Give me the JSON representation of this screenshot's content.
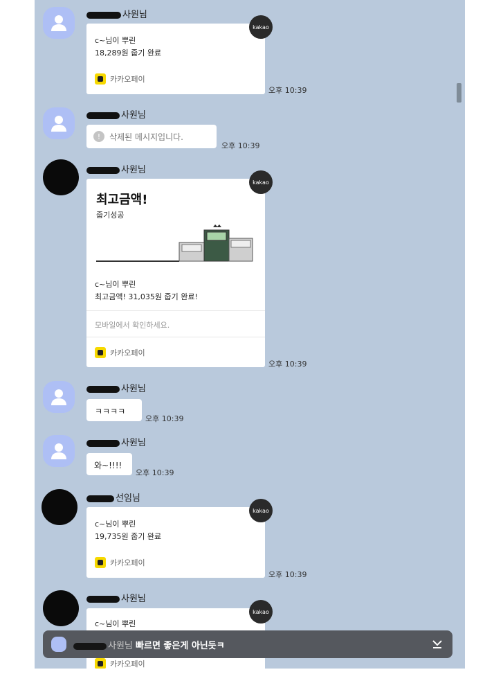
{
  "messages": [
    {
      "name_suffix": "사원님",
      "type": "pay",
      "badge": "kakao",
      "line1": "c~님이 뿌린",
      "line2": "18,289원 줍기 완료",
      "pay_label": "카카오페이",
      "time": "오후 10:39"
    },
    {
      "name_suffix": "사원님",
      "type": "deleted",
      "text": "삭제된 메시지입니다.",
      "time": "오후 10:39"
    },
    {
      "name_suffix": "사원님",
      "type": "pay-best",
      "badge": "kakao",
      "headline": "최고금액!",
      "sub": "줍기성공",
      "line1": "c~님이 뿌린",
      "line2": "최고금액! 31,035원 줍기 완료!",
      "mobile": "모바일에서 확인하세요.",
      "pay_label": "카카오페이",
      "time": "오후 10:39"
    },
    {
      "name_suffix": "사원님",
      "type": "text",
      "text": "ㅋㅋㅋㅋ",
      "time": "오후 10:39"
    },
    {
      "name_suffix": "사원님",
      "type": "text",
      "text": "와~!!!!",
      "time": "오후 10:39"
    },
    {
      "name_suffix": "선임님",
      "type": "pay",
      "badge": "kakao",
      "line1": "c~님이 뿌린",
      "line2": "19,735원 줍기 완료",
      "pay_label": "카카오페이",
      "time": "오후 10:39"
    },
    {
      "name_suffix": "사원님",
      "type": "pay",
      "badge": "kakao",
      "line1": "c~님이 뿌린",
      "pay_label": "카카오페이"
    }
  ],
  "notice": {
    "who": "사원님",
    "text": "빠르면 좋은게 아닌듯ㅋ"
  }
}
